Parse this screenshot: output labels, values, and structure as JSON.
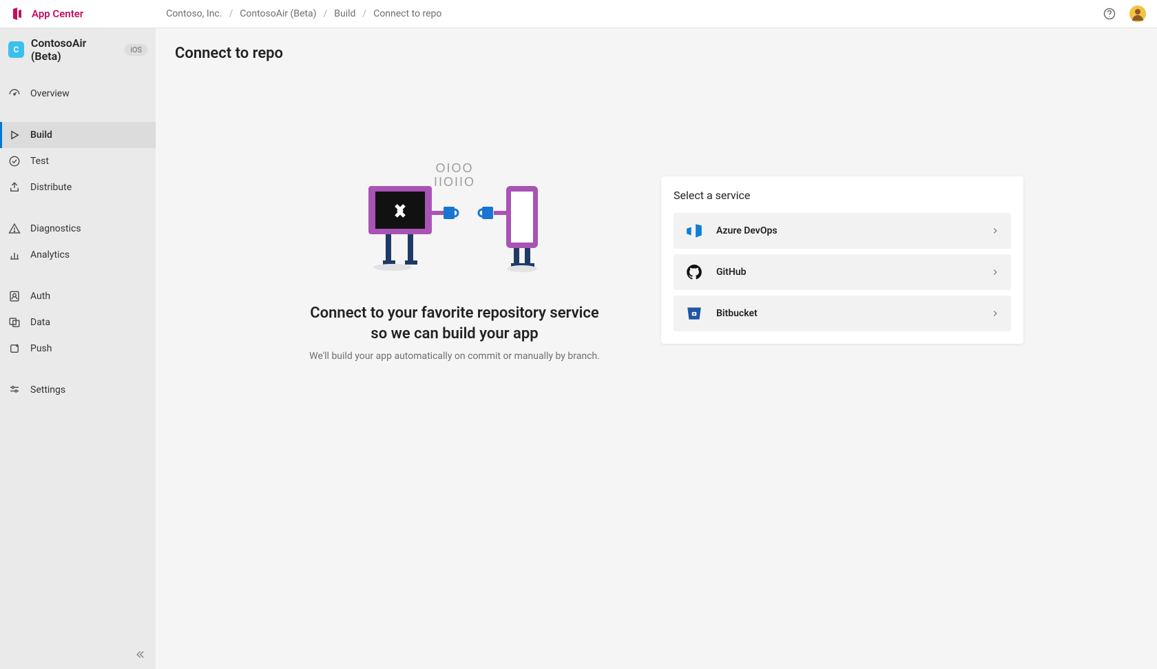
{
  "brand": "App Center",
  "breadcrumb": [
    "Contoso, Inc.",
    "ContosoAir (Beta)",
    "Build",
    "Connect to repo"
  ],
  "sidebar": {
    "app_name": "ContosoAir (Beta)",
    "app_initial": "C",
    "platform": "iOS",
    "groups": [
      {
        "items": [
          {
            "label": "Overview"
          }
        ]
      },
      {
        "items": [
          {
            "label": "Build",
            "active": true
          },
          {
            "label": "Test"
          },
          {
            "label": "Distribute"
          }
        ]
      },
      {
        "items": [
          {
            "label": "Diagnostics"
          },
          {
            "label": "Analytics"
          }
        ]
      },
      {
        "items": [
          {
            "label": "Auth"
          },
          {
            "label": "Data"
          },
          {
            "label": "Push"
          }
        ]
      },
      {
        "items": [
          {
            "label": "Settings"
          }
        ]
      }
    ]
  },
  "page": {
    "title": "Connect to repo",
    "empty_heading": "Connect to your favorite repository service so we can build your app",
    "empty_sub": "We'll build your app automatically on commit or manually by branch.",
    "binary_top": "OIOO",
    "binary_bottom": "IIOIIO",
    "card_title": "Select a service",
    "services": [
      {
        "label": "Azure DevOps"
      },
      {
        "label": "GitHub"
      },
      {
        "label": "Bitbucket"
      }
    ]
  }
}
